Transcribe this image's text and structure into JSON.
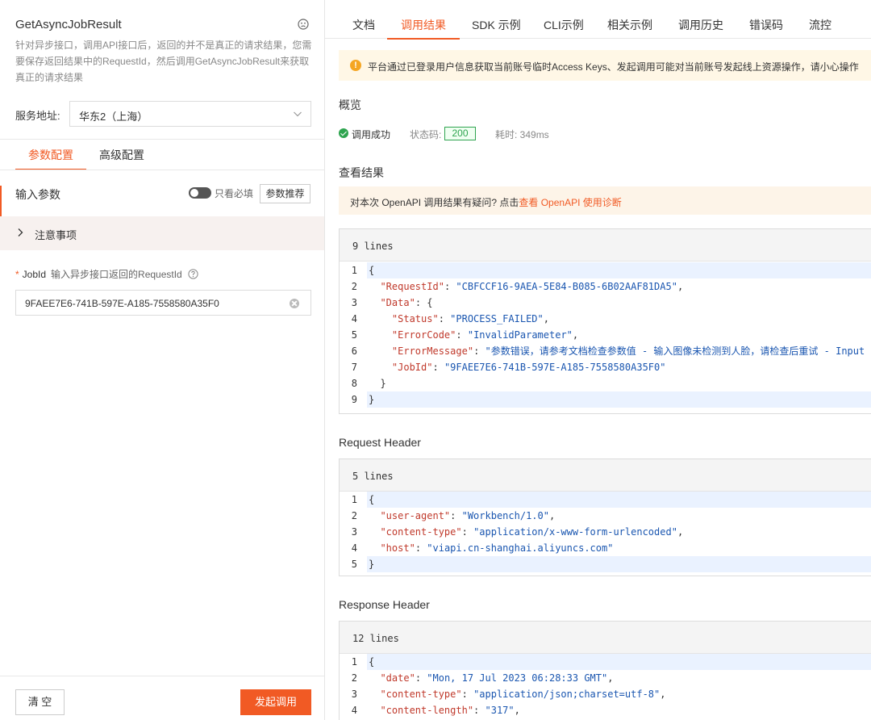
{
  "left": {
    "api_title": "GetAsyncJobResult",
    "api_desc": "针对异步接口，调用API接口后，返回的并不是真正的请求结果，您需要保存返回结果中的RequestId，然后调用GetAsyncJobResult来获取真正的请求结果",
    "service_label": "服务地址:",
    "service_value": "华东2（上海）",
    "tabs": [
      {
        "label": "参数配置"
      },
      {
        "label": "高级配置"
      }
    ],
    "input_params_label": "输入参数",
    "required_toggle_label": "只看必填",
    "recommend_button": "参数推荐",
    "notice_label": "注意事项",
    "jobid": {
      "required_mark": "*",
      "name": "JobId",
      "desc": "输入异步接口返回的RequestId",
      "value": "9FAEE7E6-741B-597E-A185-7558580A35F0"
    },
    "clear_button": "清 空",
    "invoke_button": "发起调用"
  },
  "right": {
    "tabs": [
      {
        "label": "文档"
      },
      {
        "label": "调用结果"
      },
      {
        "label": "SDK 示例"
      },
      {
        "label": "CLI示例"
      },
      {
        "label": "相关示例"
      },
      {
        "label": "调用历史"
      },
      {
        "label": "错误码"
      },
      {
        "label": "流控"
      }
    ],
    "active_tab": "调用结果",
    "warning_icon": "!",
    "warning_text": "平台通过已登录用户信息获取当前账号临时Access Keys、发起调用可能对当前账号发起线上资源操作，请小心操作",
    "overview_title": "概览",
    "success_text": "调用成功",
    "status_label": "状态码:",
    "status_code": "200",
    "elapsed": "耗时: 349ms",
    "result_title": "查看结果",
    "diag_text": "对本次 OpenAPI 调用结果有疑问? 点击",
    "diag_link": "查看 OpenAPI 使用诊断",
    "result_block": {
      "lines_label": "9 lines",
      "lines": [
        {
          "n": "1",
          "text": "{"
        },
        {
          "n": "2",
          "key": "\"RequestId\"",
          "sep": ": ",
          "val": "\"CBFCCF16-9AEA-5E84-B085-6B02AAF81DA5\"",
          "tail": ",",
          "indent": "  "
        },
        {
          "n": "3",
          "key": "\"Data\"",
          "sep": ": {",
          "val": "",
          "tail": "",
          "indent": "  "
        },
        {
          "n": "4",
          "key": "\"Status\"",
          "sep": ": ",
          "val": "\"PROCESS_FAILED\"",
          "tail": ",",
          "indent": "    "
        },
        {
          "n": "5",
          "key": "\"ErrorCode\"",
          "sep": ": ",
          "val": "\"InvalidParameter\"",
          "tail": ",",
          "indent": "    "
        },
        {
          "n": "6",
          "key": "\"ErrorMessage\"",
          "sep": ": ",
          "val": "\"参数错误，请参考文档检查参数值 - 输入图像未检测到人脸，请检查后重试 - Input image",
          "tail": "",
          "indent": "    "
        },
        {
          "n": "7",
          "key": "\"JobId\"",
          "sep": ": ",
          "val": "\"9FAEE7E6-741B-597E-A185-7558580A35F0\"",
          "tail": "",
          "indent": "    "
        },
        {
          "n": "8",
          "text": "  }"
        },
        {
          "n": "9",
          "text": "}"
        }
      ]
    },
    "request_header_title": "Request Header",
    "request_block": {
      "lines_label": "5 lines",
      "lines": [
        {
          "n": "1",
          "text": "{"
        },
        {
          "n": "2",
          "key": "\"user-agent\"",
          "sep": ": ",
          "val": "\"Workbench/1.0\"",
          "tail": ",",
          "indent": "  "
        },
        {
          "n": "3",
          "key": "\"content-type\"",
          "sep": ": ",
          "val": "\"application/x-www-form-urlencoded\"",
          "tail": ",",
          "indent": "  "
        },
        {
          "n": "4",
          "key": "\"host\"",
          "sep": ": ",
          "val": "\"viapi.cn-shanghai.aliyuncs.com\"",
          "tail": "",
          "indent": "  "
        },
        {
          "n": "5",
          "text": "}"
        }
      ]
    },
    "response_header_title": "Response Header",
    "response_block": {
      "lines_label": "12 lines",
      "lines": [
        {
          "n": "1",
          "text": "{"
        },
        {
          "n": "2",
          "key": "\"date\"",
          "sep": ": ",
          "val": "\"Mon, 17 Jul 2023 06:28:33 GMT\"",
          "tail": ",",
          "indent": "  "
        },
        {
          "n": "3",
          "key": "\"content-type\"",
          "sep": ": ",
          "val": "\"application/json;charset=utf-8\"",
          "tail": ",",
          "indent": "  "
        },
        {
          "n": "4",
          "key": "\"content-length\"",
          "sep": ": ",
          "val": "\"317\"",
          "tail": ",",
          "indent": "  "
        }
      ]
    }
  }
}
